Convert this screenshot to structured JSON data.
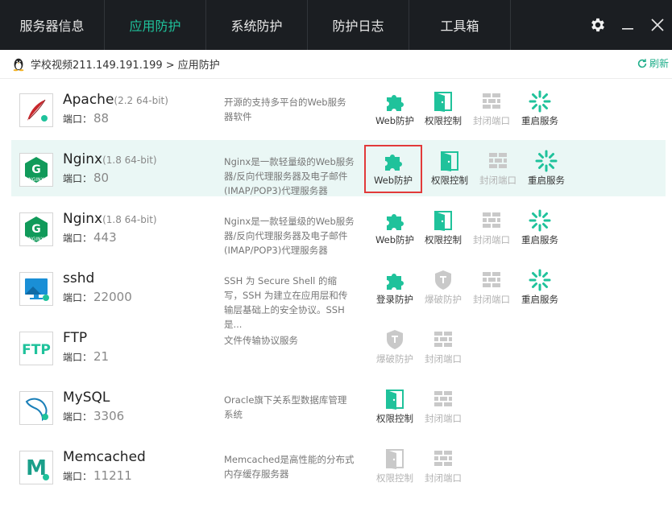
{
  "nav": {
    "tabs": [
      "服务器信息",
      "应用防护",
      "系统防护",
      "防护日志",
      "工具箱"
    ],
    "active_index": 1,
    "settings_icon": "gear-icon",
    "minimize_icon": "minimize-icon",
    "close_icon": "close-icon"
  },
  "breadcrumb": {
    "path": "学校视频211.149.191.199 > 应用防护",
    "refresh_label": "刷新"
  },
  "colors": {
    "accent": "#1fc29b",
    "nav_bg": "#1b1e22",
    "highlight_row": "#eaf7f5",
    "disabled": "#b3b3b3",
    "focus_box": "#e23a3a"
  },
  "services": [
    {
      "name": "Apache",
      "version": "(2.2 64-bit)",
      "port_label": "端口：",
      "port": "88",
      "desc": "开源的支持多平台的Web服务器软件",
      "icon": "apache-feather-icon",
      "actions": [
        {
          "label": "Web防护",
          "icon": "puzzle-icon",
          "enabled": true
        },
        {
          "label": "权限控制",
          "icon": "door-icon",
          "enabled": true
        },
        {
          "label": "封闭端口",
          "icon": "brick-wall-icon",
          "enabled": false
        },
        {
          "label": "重启服务",
          "icon": "spinner-icon",
          "enabled": true
        }
      ]
    },
    {
      "name": "Nginx",
      "version": "(1.8 64-bit)",
      "port_label": "端口：",
      "port": "80",
      "desc": "Nginx是一款轻量级的Web服务器/反向代理服务器及电子邮件(IMAP/POP3)代理服务器",
      "icon": "nginx-icon",
      "highlighted": true,
      "actions": [
        {
          "label": "Web防护",
          "icon": "puzzle-icon",
          "enabled": true,
          "boxed": true
        },
        {
          "label": "权限控制",
          "icon": "door-icon",
          "enabled": true
        },
        {
          "label": "封闭端口",
          "icon": "brick-wall-icon",
          "enabled": false
        },
        {
          "label": "重启服务",
          "icon": "spinner-icon",
          "enabled": true
        }
      ]
    },
    {
      "name": "Nginx",
      "version": "(1.8 64-bit)",
      "port_label": "端口：",
      "port": "443",
      "desc": "Nginx是一款轻量级的Web服务器/反向代理服务器及电子邮件(IMAP/POP3)代理服务器",
      "icon": "nginx-icon",
      "actions": [
        {
          "label": "Web防护",
          "icon": "puzzle-icon",
          "enabled": true
        },
        {
          "label": "权限控制",
          "icon": "door-icon",
          "enabled": true
        },
        {
          "label": "封闭端口",
          "icon": "brick-wall-icon",
          "enabled": false
        },
        {
          "label": "重启服务",
          "icon": "spinner-icon",
          "enabled": true
        }
      ]
    },
    {
      "name": "sshd",
      "version": "",
      "port_label": "端口：",
      "port": "22000",
      "desc": "SSH 为 Secure Shell 的缩写，SSH 为建立在应用层和传输层基础上的安全协议。SSH 是...",
      "icon": "monitor-icon",
      "actions": [
        {
          "label": "登录防护",
          "icon": "puzzle-icon",
          "enabled": true
        },
        {
          "label": "爆破防护",
          "icon": "shield-icon",
          "enabled": false
        },
        {
          "label": "封闭端口",
          "icon": "brick-wall-icon",
          "enabled": false
        },
        {
          "label": "重启服务",
          "icon": "spinner-icon",
          "enabled": true
        }
      ]
    },
    {
      "name": "FTP",
      "version": "",
      "port_label": "端口：",
      "port": "21",
      "desc": "文件传输协议服务",
      "icon": "ftp-icon",
      "actions": [
        {
          "label": "爆破防护",
          "icon": "shield-icon",
          "enabled": false
        },
        {
          "label": "封闭端口",
          "icon": "brick-wall-icon",
          "enabled": false
        }
      ]
    },
    {
      "name": "MySQL",
      "version": "",
      "port_label": "端口：",
      "port": "3306",
      "desc": "Oracle旗下关系型数据库管理系统",
      "icon": "mysql-dolphin-icon",
      "actions": [
        {
          "label": "权限控制",
          "icon": "door-icon",
          "enabled": true
        },
        {
          "label": "封闭端口",
          "icon": "brick-wall-icon",
          "enabled": false
        }
      ]
    },
    {
      "name": "Memcached",
      "version": "",
      "port_label": "端口：",
      "port": "11211",
      "desc": "Memcached是高性能的分布式内存缓存服务器",
      "icon": "memcached-icon",
      "actions": [
        {
          "label": "权限控制",
          "icon": "door-icon",
          "enabled": false
        },
        {
          "label": "封闭端口",
          "icon": "brick-wall-icon",
          "enabled": false
        }
      ]
    }
  ]
}
